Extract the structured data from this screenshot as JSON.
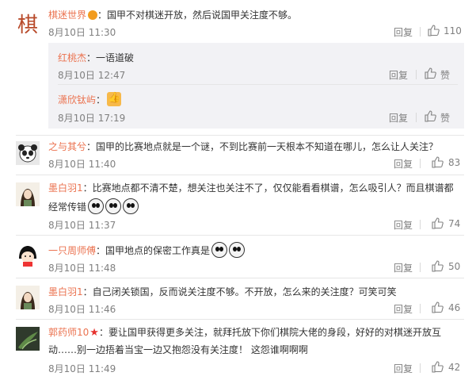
{
  "icons": {
    "like": "thumbs-up-outline-icon"
  },
  "colors": {
    "name": "#eb7350",
    "meta": "#808080",
    "sub_bg": "#f2f2f5"
  },
  "comments": [
    {
      "user": "棋迷世界",
      "text": "：国甲不对棋迷开放，然后说国甲关注度不够。",
      "time": "8月10日 11:30",
      "reply": "回复",
      "likes": "110",
      "replies": [
        {
          "user": "红桃杰",
          "text": "：一语道破",
          "time": "8月10日 12:47",
          "reply": "回复",
          "likes": "赞"
        },
        {
          "user": "潇欣钛屿",
          "text": "：",
          "time": "8月10日 17:19",
          "reply": "回复",
          "likes": "赞"
        }
      ]
    },
    {
      "user": "之与其兮",
      "text": "：国甲的比赛地点就是一个谜，不到比赛前一天根本不知道在哪儿，怎么让人关注？",
      "time": "8月10日 11:40",
      "reply": "回复",
      "likes": "83"
    },
    {
      "user": "墨白羽1",
      "text1": "：比赛地点都不清不楚，想关注也关注不了，仅仅能看看棋谱，怎么吸引人？而且棋谱都",
      "text2": "经常传错",
      "time": "8月10日 11:37",
      "reply": "回复",
      "likes": "74"
    },
    {
      "user": "一只周师傅",
      "text": "：国甲地点的保密工作真是",
      "time": "8月10日 11:48",
      "reply": "回复",
      "likes": "50"
    },
    {
      "user": "墨白羽1",
      "text": "：自己闭关锁国，反而说关注度不够。不开放，怎么来的关注度？可笑可笑",
      "time": "8月10日 11:46",
      "reply": "回复",
      "likes": "46"
    },
    {
      "user": "郭药师10",
      "text1": "：要让国甲获得更多关注，就拜托放下你们棋院大佬的身段，好好的对棋迷开放互",
      "text2": "动……别一边捂着当宝一边又抱怨没有关注度！ 这怨谁啊啊啊",
      "time": "8月10日 11:49",
      "reply": "回复",
      "likes": "42"
    }
  ]
}
